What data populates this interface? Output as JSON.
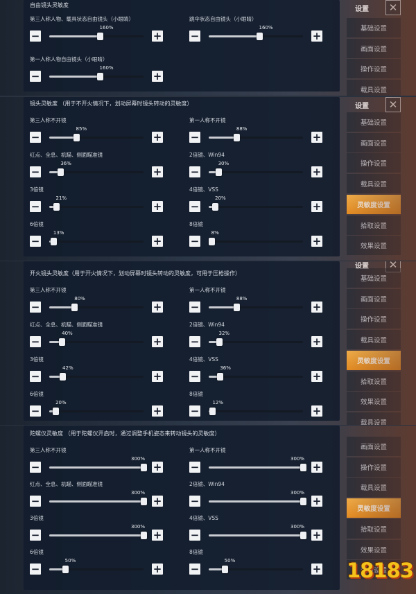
{
  "screens": [
    {
      "panel_title": "自由镜头灵敏度",
      "settings": [
        {
          "label": "第三人称人物、载具状态自由镜头（小眼睛）",
          "value_text": "160%",
          "value": 160,
          "max": 300
        },
        {
          "label": "跳伞状态自由镜头（小眼睛）",
          "value_text": "160%",
          "value": 160,
          "max": 300
        },
        {
          "label": "第一人称人物自由镜头（小眼睛）",
          "value_text": "160%",
          "value": 160,
          "max": 300
        }
      ],
      "sidebar": {
        "title": "设置",
        "items": [
          {
            "label": "基础设置",
            "active": false
          },
          {
            "label": "画面设置",
            "active": false
          },
          {
            "label": "操作设置",
            "active": false
          },
          {
            "label": "载具设置",
            "active": false
          }
        ]
      }
    },
    {
      "panel_title": "镜头灵敏度 （用于不开火情况下，划动屏幕时镜头转动的灵敏度）",
      "settings": [
        {
          "label": "第三人称不开镜",
          "value_text": "85%",
          "value": 85,
          "max": 300
        },
        {
          "label": "第一人称不开镜",
          "value_text": "88%",
          "value": 88,
          "max": 300
        },
        {
          "label": "红点、全息、机瞄、侧面瞄准镜",
          "value_text": "36%",
          "value": 36,
          "max": 300
        },
        {
          "label": "2倍镜、Win94",
          "value_text": "30%",
          "value": 30,
          "max": 300
        },
        {
          "label": "3倍镜",
          "value_text": "21%",
          "value": 21,
          "max": 300
        },
        {
          "label": "4倍镜、VSS",
          "value_text": "20%",
          "value": 20,
          "max": 300
        },
        {
          "label": "6倍镜",
          "value_text": "13%",
          "value": 13,
          "max": 300
        },
        {
          "label": "8倍镜",
          "value_text": "8%",
          "value": 8,
          "max": 300
        }
      ],
      "sidebar": {
        "title": "设置",
        "items": [
          {
            "label": "基础设置",
            "active": false
          },
          {
            "label": "画面设置",
            "active": false
          },
          {
            "label": "操作设置",
            "active": false
          },
          {
            "label": "载具设置",
            "active": false
          },
          {
            "label": "灵敏度设置",
            "active": true
          },
          {
            "label": "拾取设置",
            "active": false
          },
          {
            "label": "效果设置",
            "active": false
          }
        ]
      }
    },
    {
      "panel_title": "开火镜头灵敏度（用于开火情况下，划动屏幕时镜头转动的灵敏度，可用于压枪操作）",
      "settings": [
        {
          "label": "第三人称不开镜",
          "value_text": "80%",
          "value": 80,
          "max": 300
        },
        {
          "label": "第一人称不开镜",
          "value_text": "88%",
          "value": 88,
          "max": 300
        },
        {
          "label": "红点、全息、机瞄、侧面瞄准镜",
          "value_text": "40%",
          "value": 40,
          "max": 300
        },
        {
          "label": "2倍镜、Win94",
          "value_text": "32%",
          "value": 32,
          "max": 300
        },
        {
          "label": "3倍镜",
          "value_text": "42%",
          "value": 42,
          "max": 300
        },
        {
          "label": "4倍镜、VSS",
          "value_text": "36%",
          "value": 36,
          "max": 300
        },
        {
          "label": "6倍镜",
          "value_text": "20%",
          "value": 20,
          "max": 300
        },
        {
          "label": "8倍镜",
          "value_text": "12%",
          "value": 12,
          "max": 300
        }
      ],
      "sidebar": {
        "title": "设置",
        "items": [
          {
            "label": "基础设置",
            "active": false
          },
          {
            "label": "画面设置",
            "active": false
          },
          {
            "label": "操作设置",
            "active": false
          },
          {
            "label": "载具设置",
            "active": false
          },
          {
            "label": "灵敏度设置",
            "active": true
          },
          {
            "label": "拾取设置",
            "active": false
          },
          {
            "label": "效果设置",
            "active": false
          },
          {
            "label": "载具设置",
            "active": false
          }
        ]
      }
    },
    {
      "panel_title": "陀螺仪灵敏度 （用于陀螺仪开启时，通过调整手机姿态来转动镜头的灵敏度）",
      "settings": [
        {
          "label": "第三人称不开镜",
          "value_text": "300%",
          "value": 300,
          "max": 300
        },
        {
          "label": "第一人称不开镜",
          "value_text": "300%",
          "value": 300,
          "max": 300
        },
        {
          "label": "红点、全息、机瞄、侧面瞄准镜",
          "value_text": "300%",
          "value": 300,
          "max": 300
        },
        {
          "label": "2倍镜、Win94",
          "value_text": "300%",
          "value": 300,
          "max": 300
        },
        {
          "label": "3倍镜",
          "value_text": "300%",
          "value": 300,
          "max": 300
        },
        {
          "label": "4倍镜、VSS",
          "value_text": "300%",
          "value": 300,
          "max": 300
        },
        {
          "label": "6倍镜",
          "value_text": "50%",
          "value": 50,
          "max": 300
        },
        {
          "label": "8倍镜",
          "value_text": "50%",
          "value": 50,
          "max": 300
        }
      ],
      "sidebar": {
        "title": "",
        "items": [
          {
            "label": "画面设置",
            "active": false
          },
          {
            "label": "操作设置",
            "active": false
          },
          {
            "label": "载具设置",
            "active": false
          },
          {
            "label": "灵敏度设置",
            "active": true
          },
          {
            "label": "拾取设置",
            "active": false
          },
          {
            "label": "效果设置",
            "active": false
          },
          {
            "label": "录像设置",
            "active": false
          }
        ]
      }
    }
  ],
  "watermark": {
    "text": "18183"
  }
}
